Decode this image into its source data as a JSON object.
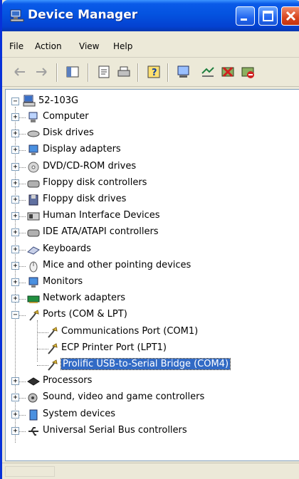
{
  "window": {
    "title": "Device Manager"
  },
  "menu": {
    "file": "File",
    "action": "Action",
    "view": "View",
    "help": "Help"
  },
  "toolbar": {
    "icons": [
      "back-icon",
      "forward-icon",
      "show-hide-console-tree-icon",
      "properties-icon",
      "print-icon",
      "help-icon",
      "scan-hardware-icon",
      "update-driver-icon",
      "uninstall-icon",
      "disable-icon"
    ]
  },
  "tree": {
    "root": "52-103G",
    "categories": [
      {
        "label": "Computer",
        "icon": "computer-icon"
      },
      {
        "label": "Disk drives",
        "icon": "disk-drive-icon"
      },
      {
        "label": "Display adapters",
        "icon": "display-adapter-icon"
      },
      {
        "label": "DVD/CD-ROM drives",
        "icon": "cdrom-icon"
      },
      {
        "label": "Floppy disk controllers",
        "icon": "floppy-controller-icon"
      },
      {
        "label": "Floppy disk drives",
        "icon": "floppy-drive-icon"
      },
      {
        "label": "Human Interface Devices",
        "icon": "hid-icon"
      },
      {
        "label": "IDE ATA/ATAPI controllers",
        "icon": "ide-controller-icon"
      },
      {
        "label": "Keyboards",
        "icon": "keyboard-icon"
      },
      {
        "label": "Mice and other pointing devices",
        "icon": "mouse-icon"
      },
      {
        "label": "Monitors",
        "icon": "monitor-icon"
      },
      {
        "label": "Network adapters",
        "icon": "network-adapter-icon"
      },
      {
        "label": "Ports (COM & LPT)",
        "icon": "port-icon"
      }
    ],
    "ports_children": [
      {
        "label": "Communications Port (COM1)",
        "icon": "port-icon"
      },
      {
        "label": "ECP Printer Port (LPT1)",
        "icon": "port-icon"
      },
      {
        "label": "Prolific USB-to-Serial Bridge (COM4)",
        "icon": "port-icon",
        "selected": true
      }
    ],
    "categories_after": [
      {
        "label": "Processors",
        "icon": "processor-icon"
      },
      {
        "label": "Sound, video and game controllers",
        "icon": "sound-icon"
      },
      {
        "label": "System devices",
        "icon": "system-device-icon"
      },
      {
        "label": "Universal Serial Bus controllers",
        "icon": "usb-icon"
      }
    ]
  },
  "colors": {
    "titlebar": "#0453e0",
    "selection": "#316ac5",
    "chrome": "#ece9d8"
  }
}
